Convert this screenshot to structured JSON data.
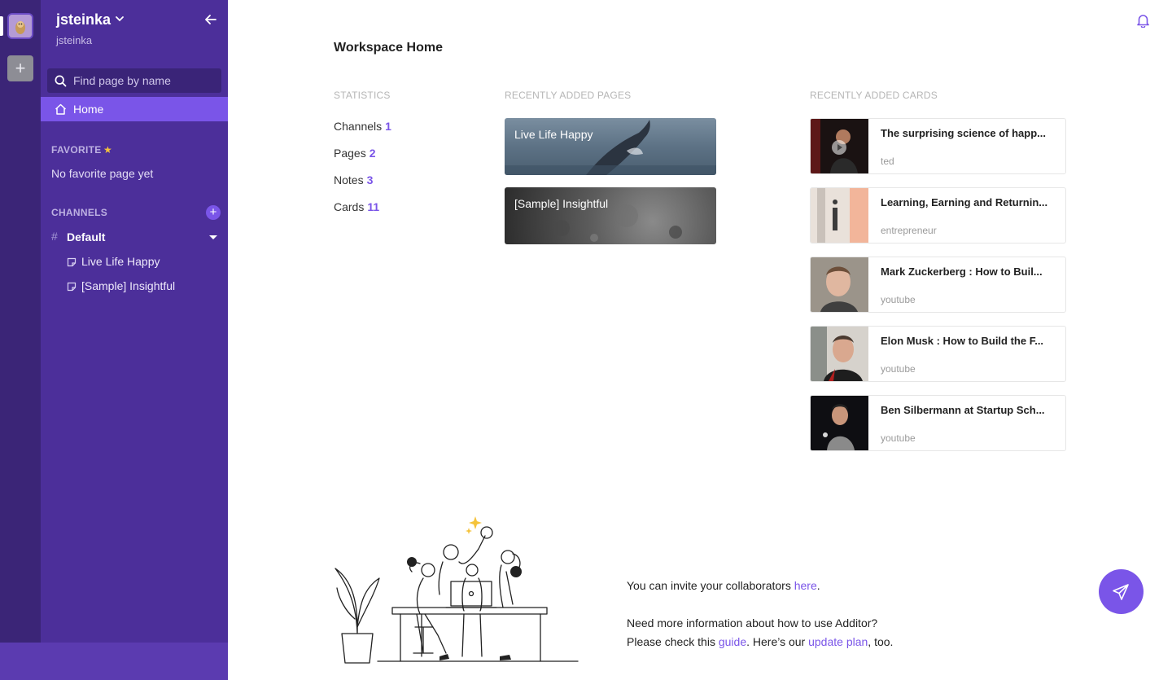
{
  "workspace": {
    "name": "jsteinka",
    "subtitle": "jsteinka"
  },
  "search": {
    "placeholder": "Find page by name"
  },
  "nav": {
    "home_label": "Home"
  },
  "favorite": {
    "title": "FAVORITE",
    "empty_text": "No favorite page yet"
  },
  "channels": {
    "title": "CHANNELS",
    "items": [
      {
        "name": "Default",
        "pages": [
          "Live Life Happy",
          "[Sample] Insightful"
        ]
      }
    ]
  },
  "main": {
    "title": "Workspace Home",
    "statistics_title": "STATISTICS",
    "pages_title": "RECENTLY ADDED PAGES",
    "cards_title": "RECENTLY ADDED CARDS",
    "stats": [
      {
        "label": "Channels",
        "value": "1"
      },
      {
        "label": "Pages",
        "value": "2"
      },
      {
        "label": "Notes",
        "value": "3"
      },
      {
        "label": "Cards",
        "value": "11"
      }
    ],
    "recent_pages": [
      "Live Life Happy",
      "[Sample] Insightful"
    ],
    "recent_cards": [
      {
        "title": "The surprising science of happ...",
        "source": "ted"
      },
      {
        "title": "Learning, Earning and Returnin...",
        "source": "entrepreneur"
      },
      {
        "title": "Mark Zuckerberg : How to Buil...",
        "source": "youtube"
      },
      {
        "title": "Elon Musk : How to Build the F...",
        "source": "youtube"
      },
      {
        "title": "Ben Silbermann at Startup Sch...",
        "source": "youtube"
      }
    ],
    "invite": {
      "prefix": "You can invite your collaborators ",
      "link": "here",
      "suffix": "."
    },
    "help": {
      "line1": "Need more information about how to use Additor?",
      "prefix": "Please check this ",
      "guide_link": "guide",
      "middle": ". Here’s our ",
      "plan_link": "update plan",
      "suffix": ", too."
    }
  },
  "colors": {
    "sidebar": "#4c2f9a",
    "rail": "#3b2577",
    "accent": "#7a55e8"
  }
}
